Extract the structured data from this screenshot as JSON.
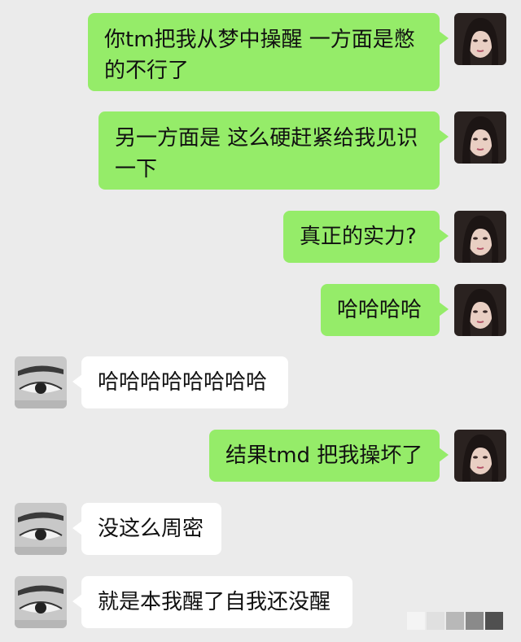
{
  "messages": [
    {
      "sender": "self",
      "text": "你tm把我从梦中操醒 一方面是憋的不行了"
    },
    {
      "sender": "self",
      "text": "另一方面是 这么硬赶紧给我见识一下"
    },
    {
      "sender": "self",
      "text": "真正的实力?"
    },
    {
      "sender": "self",
      "text": "哈哈哈哈"
    },
    {
      "sender": "other",
      "text": "哈哈哈哈哈哈哈哈"
    },
    {
      "sender": "self",
      "text": "结果tmd 把我操坏了"
    },
    {
      "sender": "other",
      "text": "没这么周密"
    },
    {
      "sender": "other",
      "text": "就是本我醒了自我还没醒"
    }
  ],
  "colors": {
    "background": "#ebebeb",
    "self_bubble": "#95ec69",
    "other_bubble": "#ffffff"
  },
  "icons": {
    "self_avatar": "female-portrait-avatar",
    "other_avatar": "eye-closeup-avatar"
  }
}
